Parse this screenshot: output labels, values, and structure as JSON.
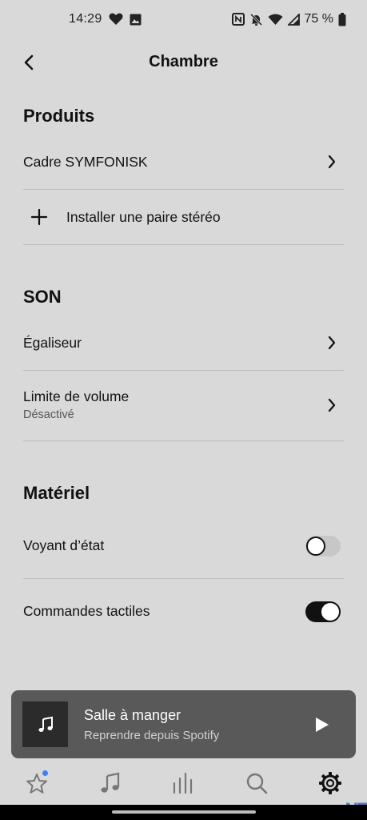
{
  "status_bar": {
    "time": "14:29",
    "battery_percent": "75 %",
    "left_icons": [
      "heart-icon",
      "image-icon"
    ],
    "right_icons": [
      "nfc-icon",
      "bell-off-icon",
      "wifi-icon",
      "signal-icon",
      "battery-icon"
    ]
  },
  "header": {
    "title": "Chambre"
  },
  "products": {
    "title": "Produits",
    "item_label": "Cadre SYMFONISK",
    "add_label": "Installer une paire stéréo"
  },
  "sound": {
    "title": "SON",
    "eq_label": "Égaliseur",
    "volume_limit_label": "Limite de volume",
    "volume_limit_value": "Désactivé"
  },
  "hardware": {
    "title": "Matériel",
    "status_light_label": "Voyant d’état",
    "status_light_on": false,
    "touch_controls_label": "Commandes tactiles",
    "touch_controls_on": true
  },
  "mini_player": {
    "title": "Salle à manger",
    "subtitle": "Reprendre depuis Spotify"
  },
  "bottom_nav": {
    "items": [
      "star-icon",
      "music-note-icon",
      "bars-icon",
      "search-icon",
      "gear-icon"
    ],
    "active": "gear-icon"
  },
  "watermark": "NT"
}
